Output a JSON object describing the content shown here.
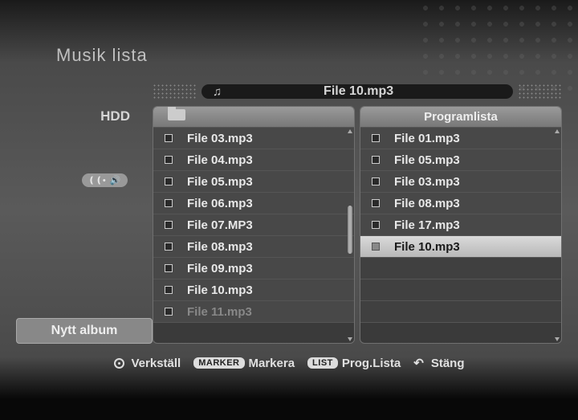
{
  "header": {
    "title": "Musik lista"
  },
  "sidebar": {
    "source_label": "HDD",
    "new_album_label": "Nytt album"
  },
  "now_playing": {
    "filename": "File 10.mp3"
  },
  "left_list": {
    "items": [
      {
        "name": "File 03.mp3",
        "dim": false
      },
      {
        "name": "File 04.mp3",
        "dim": false
      },
      {
        "name": "File 05.mp3",
        "dim": false
      },
      {
        "name": "File 06.mp3",
        "dim": false
      },
      {
        "name": "File 07.MP3",
        "dim": false
      },
      {
        "name": "File 08.mp3",
        "dim": false
      },
      {
        "name": "File 09.mp3",
        "dim": false
      },
      {
        "name": "File 10.mp3",
        "dim": false
      },
      {
        "name": "File 11.mp3",
        "dim": true
      }
    ]
  },
  "right_list": {
    "header": "Programlista",
    "items": [
      {
        "name": "File 01.mp3",
        "selected": false
      },
      {
        "name": "File 05.mp3",
        "selected": false
      },
      {
        "name": "File 03.mp3",
        "selected": false
      },
      {
        "name": "File 08.mp3",
        "selected": false
      },
      {
        "name": "File 17.mp3",
        "selected": false
      },
      {
        "name": "File 10.mp3",
        "selected": true
      }
    ],
    "blank_rows": 3
  },
  "footer": {
    "enter_label": "Verkställ",
    "marker_pill": "MARKER",
    "marker_label": "Markera",
    "list_pill": "LIST",
    "list_label": "Prog.Lista",
    "return_label": "Stäng"
  }
}
